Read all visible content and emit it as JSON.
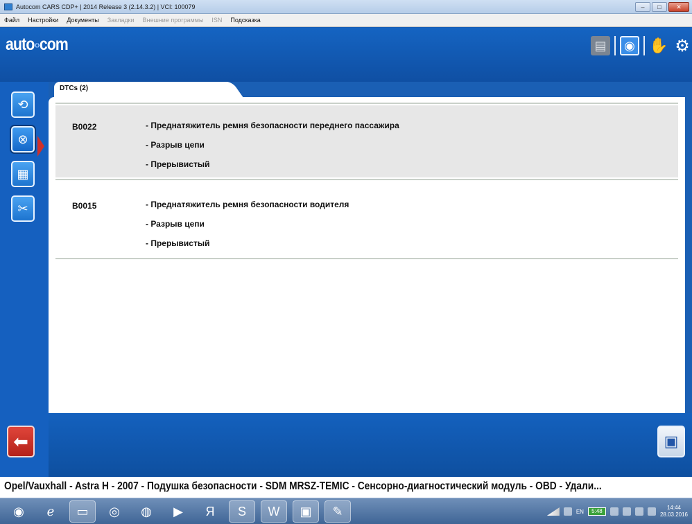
{
  "window": {
    "title": "Autocom CARS CDP+ | 2014 Release 3 (2.14.3.2) | VCI: 100079",
    "minimize": "–",
    "maximize": "□",
    "close": "✕"
  },
  "menu": {
    "items": [
      {
        "label": "Файл",
        "disabled": false
      },
      {
        "label": "Настройки",
        "disabled": false
      },
      {
        "label": "Документы",
        "disabled": false
      },
      {
        "label": "Закладки",
        "disabled": true
      },
      {
        "label": "Внешние программы",
        "disabled": true
      },
      {
        "label": "ISN",
        "disabled": true
      },
      {
        "label": "Подсказка",
        "disabled": false
      }
    ]
  },
  "header": {
    "logo_left": "auto",
    "logo_right": "com",
    "icons": [
      "device-icon",
      "diagnostic-icon",
      "hand-icon",
      "settings-gear-icon"
    ]
  },
  "tab": {
    "label": "DTCs (2)"
  },
  "dtcs": [
    {
      "code": "B0022",
      "lines": [
        "- Преднатяжитель ремня безопасности переднего пассажира",
        "- Разрыв цепи",
        "- Прерывистый"
      ]
    },
    {
      "code": "B0015",
      "lines": [
        "- Преднатяжитель ремня безопасности водителя",
        "- Разрыв цепи",
        "- Прерывистый"
      ]
    }
  ],
  "status": {
    "vehicle_line": "Opel/Vauxhall - Astra H - 2007 - Подушка безопасности - SDM MRSZ-TEMIC - Сенсорно-диагностический модуль - OBD - Удали..."
  },
  "taskbar": {
    "battery": "5:48",
    "lang": "EN",
    "time": "14:44",
    "date": "28.03.2016"
  },
  "colors": {
    "brand_blue": "#1564c2",
    "back_red": "#d0302a"
  }
}
